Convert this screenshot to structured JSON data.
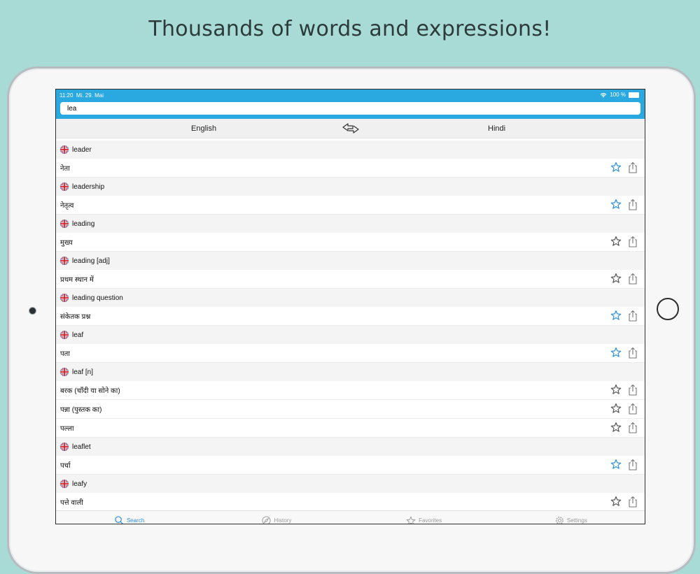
{
  "headline": "Thousands of words and expressions!",
  "status": {
    "time": "11:20",
    "date": "Mi. 29. Mai",
    "battery": "100 %"
  },
  "search": {
    "value": "lea"
  },
  "languages": {
    "source": "English",
    "target": "Hindi"
  },
  "entries": [
    {
      "word": "leader",
      "translations": [
        {
          "text": "नेता",
          "favorite": true
        }
      ]
    },
    {
      "word": "leadership",
      "translations": [
        {
          "text": "नेतृत्व",
          "favorite": true
        }
      ]
    },
    {
      "word": "leading",
      "translations": [
        {
          "text": "मुख्य",
          "favorite": false
        }
      ]
    },
    {
      "word": "leading [adj]",
      "translations": [
        {
          "text": "प्रथम स्थान में",
          "favorite": false
        }
      ]
    },
    {
      "word": "leading question",
      "translations": [
        {
          "text": "संकेतक प्रश्न",
          "favorite": true
        }
      ]
    },
    {
      "word": "leaf",
      "translations": [
        {
          "text": "पता",
          "favorite": true
        }
      ]
    },
    {
      "word": "leaf [n]",
      "translations": [
        {
          "text": "बरक (चाँदी या सोने का)",
          "favorite": false
        },
        {
          "text": "पन्ना (पुस्तक का)",
          "favorite": false
        },
        {
          "text": "पल्ला",
          "favorite": false
        }
      ]
    },
    {
      "word": "leaflet",
      "translations": [
        {
          "text": "पर्चा",
          "favorite": true
        }
      ]
    },
    {
      "word": "leafy",
      "translations": [
        {
          "text": "पत्ते वाली",
          "favorite": false
        }
      ]
    }
  ],
  "tabs": [
    {
      "label": "Search",
      "icon": "search-icon",
      "active": true
    },
    {
      "label": "History",
      "icon": "compass-icon",
      "active": false
    },
    {
      "label": "Favorites",
      "icon": "star-icon",
      "active": false
    },
    {
      "label": "Settings",
      "icon": "gear-icon",
      "active": false
    }
  ],
  "colors": {
    "accent": "#2aa8e0",
    "favorite": "#2a8ee0",
    "background": "#a8dad6"
  }
}
